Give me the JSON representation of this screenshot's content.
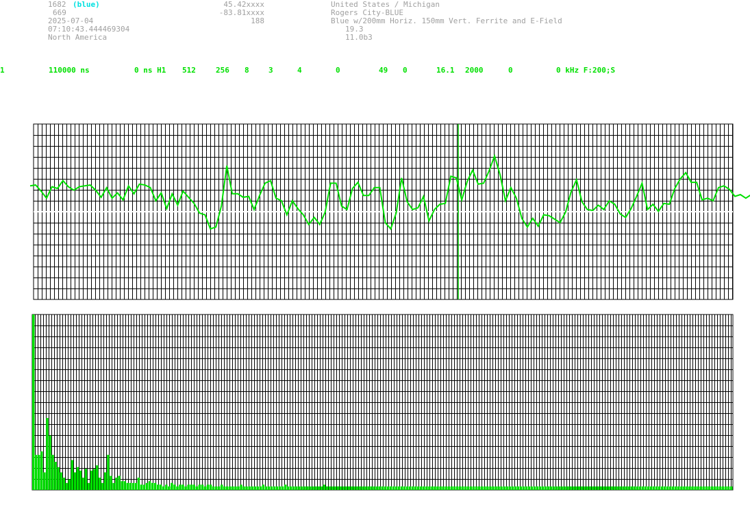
{
  "header": {
    "station_id": "1682",
    "station_tag": "(blue)",
    "count": "669",
    "date": "2025-07-04",
    "time": "07:10:43.444469304",
    "region": "North America",
    "latitude": "45.42xxxx",
    "longitude": "-83.81xxxx",
    "altitude": "188",
    "country_state": "United States / Michigan",
    "city": "Rogers City-BLUE",
    "antenna": "Blue w/200mm Horiz. 150mm Vert. Ferrite and E-Field",
    "value_a": "19.3",
    "value_b": "11.0b3"
  },
  "params_row": [
    "1",
    "110000 ns",
    "0 ns H1",
    "512",
    "256",
    "8",
    "3",
    "4",
    "0",
    "49",
    "0",
    "16.1",
    "2000",
    "0",
    "0 kHz F:200;S"
  ],
  "colors": {
    "text_gray": "#a0a0a0",
    "text_cyan": "#00e0e0",
    "text_green": "#00e000",
    "trace_green": "#00e000",
    "grid": "#000000",
    "marker": "#00c000",
    "baseline": "#ffffff"
  },
  "chart_data": [
    {
      "type": "line",
      "title": "",
      "xlabel": "",
      "ylabel": "",
      "grid": true,
      "xlim": [
        0,
        1024
      ],
      "ylim": [
        -1,
        1
      ],
      "marker_x": 622,
      "x_step": 8,
      "values": [
        0.27,
        0.33,
        0.21,
        0.18,
        0.26,
        0.29,
        0.33,
        0.31,
        0.22,
        0.31,
        0.27,
        0.33,
        0.22,
        0.19,
        0.25,
        0.18,
        0.19,
        0.16,
        0.27,
        0.23,
        0.29,
        0.33,
        0.25,
        0.15,
        0.19,
        0.06,
        0.18,
        0.1,
        0.21,
        0.19,
        0.07,
        0.01,
        -0.06,
        -0.17,
        -0.2,
        0.09,
        0.5,
        0.23,
        0.18,
        0.19,
        0.15,
        0.05,
        0.16,
        0.35,
        0.33,
        0.18,
        0.1,
        -0.01,
        0.1,
        0.06,
        -0.06,
        -0.12,
        -0.09,
        -0.12,
        -0.03,
        0.35,
        0.3,
        0.09,
        0.0,
        0.29,
        0.31,
        0.21,
        0.16,
        0.3,
        0.25,
        -0.1,
        -0.22,
        0.01,
        0.36,
        0.14,
        0.0,
        0.07,
        0.15,
        -0.08,
        0.0,
        0.11,
        0.07,
        0.43,
        0.36,
        0.16,
        0.32,
        0.5,
        0.29,
        0.35,
        0.44,
        0.66,
        0.4,
        0.15,
        0.25,
        0.18,
        -0.1,
        -0.15,
        -0.1,
        -0.14,
        -0.06,
        -0.02,
        -0.11,
        -0.1,
        -0.03,
        0.25,
        0.34,
        0.14,
        0.0,
        0.04,
        0.05,
        0.05,
        0.1,
        0.11,
        -0.05,
        -0.04,
        0.01,
        0.2,
        0.3,
        0.05,
        0.06,
        0.03,
        0.07,
        0.11,
        0.24,
        0.4,
        0.42,
        0.36,
        0.31,
        0.16,
        0.13,
        0.15,
        0.25,
        0.32,
        0.23,
        0.2,
        0.17,
        0.18,
        0.17,
        0.27,
        0.24,
        0.1,
        0.06,
        0.1,
        0.06
      ]
    },
    {
      "type": "bar",
      "title": "",
      "xlabel": "",
      "ylabel": "",
      "grid": true,
      "ylim": [
        0,
        1
      ],
      "values": [
        1.0,
        0.2,
        0.2,
        0.22,
        0.1,
        0.41,
        0.31,
        0.2,
        0.16,
        0.13,
        0.1,
        0.07,
        0.04,
        0.06,
        0.17,
        0.1,
        0.13,
        0.11,
        0.07,
        0.12,
        0.04,
        0.11,
        0.12,
        0.14,
        0.07,
        0.04,
        0.1,
        0.2,
        0.08,
        0.04,
        0.07,
        0.08,
        0.05,
        0.05,
        0.04,
        0.04,
        0.04,
        0.04,
        0.07,
        0.03,
        0.03,
        0.04,
        0.05,
        0.04,
        0.04,
        0.03,
        0.03,
        0.02,
        0.03,
        0.02,
        0.04,
        0.03,
        0.02,
        0.03,
        0.03,
        0.02,
        0.03,
        0.03,
        0.03,
        0.02,
        0.03,
        0.03,
        0.02,
        0.03,
        0.03,
        0.02,
        0.02,
        0.02,
        0.03,
        0.02,
        0.02,
        0.02,
        0.02,
        0.02,
        0.02,
        0.03,
        0.02,
        0.02,
        0.02,
        0.02,
        0.02,
        0.02,
        0.02,
        0.03,
        0.02,
        0.02,
        0.02,
        0.02,
        0.02,
        0.02,
        0.02,
        0.03,
        0.02,
        0.02,
        0.02,
        0.02,
        0.02,
        0.02,
        0.02,
        0.02,
        0.02,
        0.02,
        0.02,
        0.02,
        0.02,
        0.03,
        0.02,
        0.02,
        0.02,
        0.02,
        0.02,
        0.02,
        0.02,
        0.02,
        0.02,
        0.02,
        0.02,
        0.02,
        0.02,
        0.02,
        0.02,
        0.02,
        0.02,
        0.02,
        0.02,
        0.02,
        0.02,
        0.02,
        0.02,
        0.02,
        0.02,
        0.02,
        0.02,
        0.02,
        0.02,
        0.02,
        0.02,
        0.02,
        0.02,
        0.02,
        0.02,
        0.02,
        0.02,
        0.02,
        0.02,
        0.02,
        0.02,
        0.02,
        0.02,
        0.02,
        0.02,
        0.02,
        0.02,
        0.02,
        0.02,
        0.02,
        0.02,
        0.02,
        0.02,
        0.02,
        0.02,
        0.02,
        0.02,
        0.02,
        0.02,
        0.02,
        0.02,
        0.02,
        0.02,
        0.02,
        0.02,
        0.02,
        0.02,
        0.02,
        0.02,
        0.02,
        0.02,
        0.02,
        0.02,
        0.02,
        0.02,
        0.02,
        0.02,
        0.02,
        0.02,
        0.02,
        0.02,
        0.02,
        0.02,
        0.02,
        0.02,
        0.02,
        0.02,
        0.02,
        0.02,
        0.02,
        0.02,
        0.02,
        0.02,
        0.02,
        0.02,
        0.02,
        0.02,
        0.02,
        0.02,
        0.02,
        0.02,
        0.02,
        0.02,
        0.02,
        0.02,
        0.02,
        0.02,
        0.02,
        0.02,
        0.02,
        0.02,
        0.02,
        0.02,
        0.02,
        0.02,
        0.02,
        0.02,
        0.02,
        0.02,
        0.02,
        0.02,
        0.02,
        0.02,
        0.02,
        0.02,
        0.02,
        0.02,
        0.02,
        0.02,
        0.02,
        0.02,
        0.02,
        0.02,
        0.02,
        0.02,
        0.02,
        0.02,
        0.02,
        0.02,
        0.02,
        0.02,
        0.02,
        0.02,
        0.02,
        0.02,
        0.02,
        0.02
      ]
    }
  ]
}
